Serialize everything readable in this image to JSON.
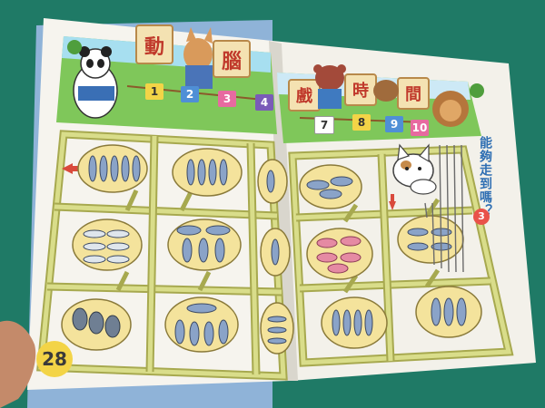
{
  "book": {
    "header_left": [
      "動",
      "腦"
    ],
    "header_right": [
      "戲",
      "時",
      "間"
    ],
    "number_tiles": [
      "1",
      "2",
      "3",
      "4",
      "7",
      "8",
      "9",
      "10"
    ],
    "question_title": "能夠走到嗎？",
    "question_number": "3",
    "page_number": "28"
  },
  "colors": {
    "table": "#1f7a66",
    "page": "#f6f4ee",
    "maze_path": "#d9dd8a",
    "maze_edge": "#a7a94f",
    "plate": "#f4e39c",
    "arrow": "#d94a3c"
  },
  "icons": [
    "panda",
    "fox",
    "bear",
    "cat",
    "fish",
    "arrow-left",
    "arrow-down"
  ]
}
